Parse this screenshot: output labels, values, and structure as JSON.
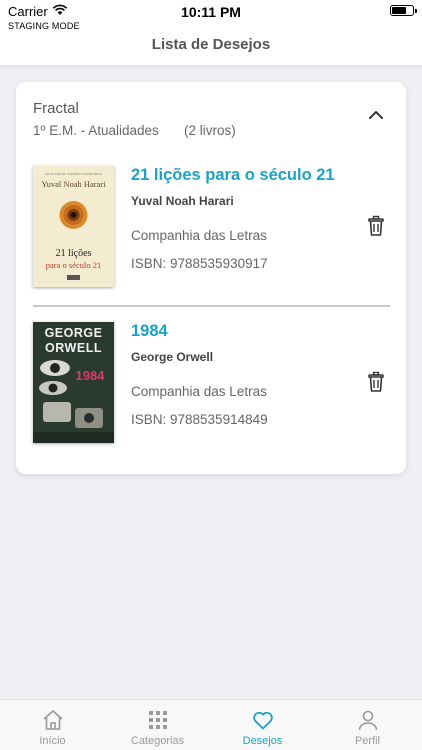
{
  "status_bar": {
    "carrier": "Carrier",
    "staging": "STAGING MODE",
    "time": "10:11 PM",
    "wifi_icon": "wifi-icon",
    "battery_icon": "battery-icon"
  },
  "nav": {
    "title": "Lista de Desejos"
  },
  "wishlist": {
    "name": "Fractal",
    "subtitle": "1º E.M. - Atualidades",
    "count": "(2 livros)",
    "expanded_icon": "chevron-up-icon",
    "books": [
      {
        "title": "21 lições para o século 21",
        "author": "Yuval Noah Harari",
        "publisher": "Companhia das Letras",
        "isbn": "ISBN: 9788535930917",
        "cover": {
          "top_text": "DO AUTOR DE SAPIENS E HOMO DEUS",
          "author": "Yuval Noah Harari",
          "title_line1": "21 lições",
          "title_line2": "para o século 21",
          "bg": "#f4ecd0",
          "accent": "#c0392b"
        }
      },
      {
        "title": "1984",
        "author": "George Orwell",
        "publisher": "Companhia das Letras",
        "isbn": "ISBN: 9788535914849",
        "cover": {
          "line1": "GEORGE",
          "line2": "ORWELL",
          "title": "1984",
          "bg": "#2b3a2f",
          "accent": "#d63a6e"
        }
      }
    ]
  },
  "tabs": [
    {
      "label": "Início",
      "icon": "home-icon",
      "active": false
    },
    {
      "label": "Categorias",
      "icon": "grid-icon",
      "active": false
    },
    {
      "label": "Desejos",
      "icon": "heart-icon",
      "active": true
    },
    {
      "label": "Perfil",
      "icon": "user-icon",
      "active": false
    }
  ],
  "colors": {
    "accent": "#1aa3c6",
    "background": "#efeff4"
  }
}
